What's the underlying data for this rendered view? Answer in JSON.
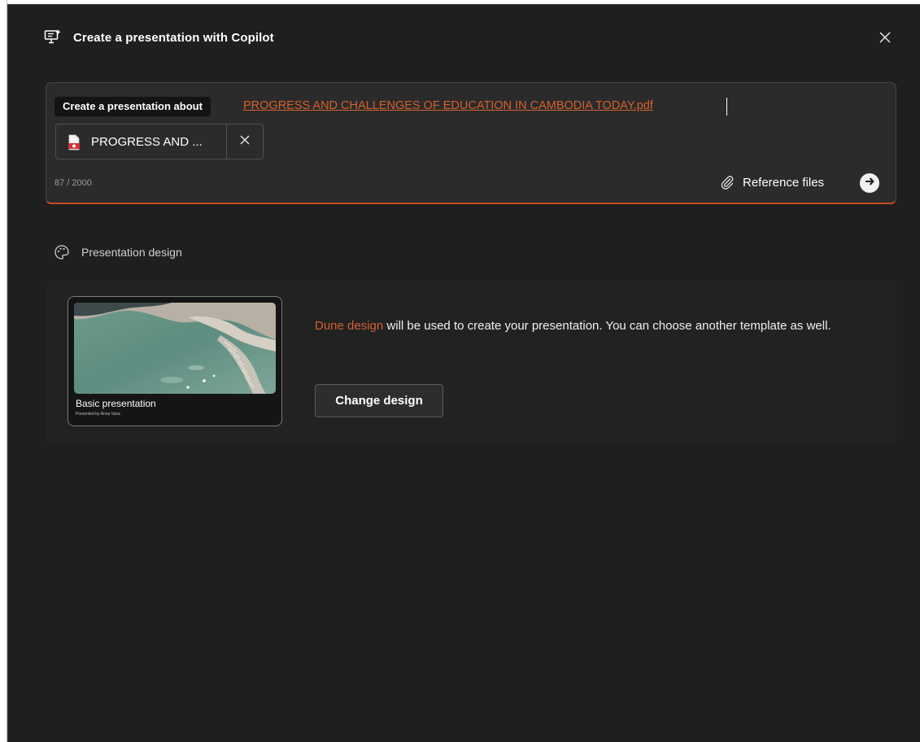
{
  "dialog": {
    "title": "Create a presentation with Copilot",
    "title_icon": "presentation-sparkle-icon",
    "close_icon": "close-icon"
  },
  "prompt": {
    "prefix": "Create a presentation about",
    "file_reference": "PROGRESS AND CHALLENGES OF EDUCATION IN CAMBODIA TODAY.pdf",
    "attachment_label": "PROGRESS AND ...",
    "attachment_icon": "pdf-file-icon",
    "remove_icon": "close-icon",
    "char_count": "87 / 2000",
    "reference_files_label": "Reference files",
    "reference_files_icon": "paperclip-icon",
    "send_icon": "arrow-right-circle-icon"
  },
  "design": {
    "section_title": "Presentation design",
    "section_icon": "palette-icon",
    "thumbnail_title": "Basic presentation",
    "thumbnail_subtitle": "Presented by Anna Vasa",
    "design_name": "Dune design",
    "description_rest": " will be used to create your presentation. You can choose another template as well.",
    "change_button": "Change design"
  },
  "colors": {
    "background": "#1f1f1f",
    "surface": "#2b2b2b",
    "accent": "#d4602e",
    "text": "#ffffff"
  }
}
